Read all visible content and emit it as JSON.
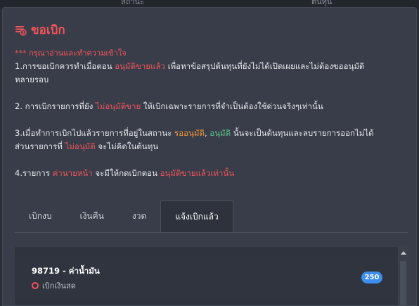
{
  "backdrop": {
    "left_text": "สถานะ",
    "right_text": "ต้นทุน"
  },
  "modal": {
    "title": "ขอเบิก",
    "icon": "money-request-icon"
  },
  "notice": {
    "warning": "*** กรุณาอ่านและทำความเข้าใจ",
    "line1_a": "1.การขอเบิกควรทำเมื่อตอน ",
    "line1_b": "อนุมัติขายแล้ว",
    "line1_c": " เพื่อหาข้อสรุปต้นทุนที่ยังไม่ได้เปิดเผยและไม่ต้องขออนุมัติ",
    "line1_d": "หลายรอบ",
    "line2_a": "2. การเบิกรายการที่ยัง ",
    "line2_b": "ไม่อนุมัติขาย",
    "line2_c": " ให้เบิกเฉพาะรายการที่จำเป็นต้องใช้ด่วนจริงๆเท่านั้น",
    "line3_a": "3.เมื่อทำการเบิกไปแล้วรายการที่อยู่ในสถานะ ",
    "line3_b": "รออนุมัติ",
    "line3_c": ", ",
    "line3_d": "อนุมัติ",
    "line3_e": " นั้นจะเป็นต้นทุนและลบรายการออกไม่ได้",
    "line3_f": "ส่วนรายการที่ ",
    "line3_g": "ไม่อนุมัติ",
    "line3_h": " จะไม่คิดในต้นทุน",
    "line4_a": "4.รายการ ",
    "line4_b": "ค่านายหน้า",
    "line4_c": " จะมีให้กดเบิกตอน ",
    "line4_d": "อนุมัติขายแล้วเท่านั้น"
  },
  "tabs": [
    {
      "label": "เบิกงบ",
      "active": false
    },
    {
      "label": "เงินคืน",
      "active": false
    },
    {
      "label": "งวด",
      "active": false
    },
    {
      "label": "แจ้งเบิกแล้ว",
      "active": true
    }
  ],
  "list": {
    "items": [
      {
        "title": "98719 - ค่าน้ำมัน",
        "status": "เบิกเงินสด",
        "badge": "250"
      }
    ]
  },
  "colors": {
    "accent_red": "#f2545b",
    "accent_orange": "#f59a3b",
    "accent_green": "#5cc98a",
    "badge_blue": "#3d8ef0"
  }
}
